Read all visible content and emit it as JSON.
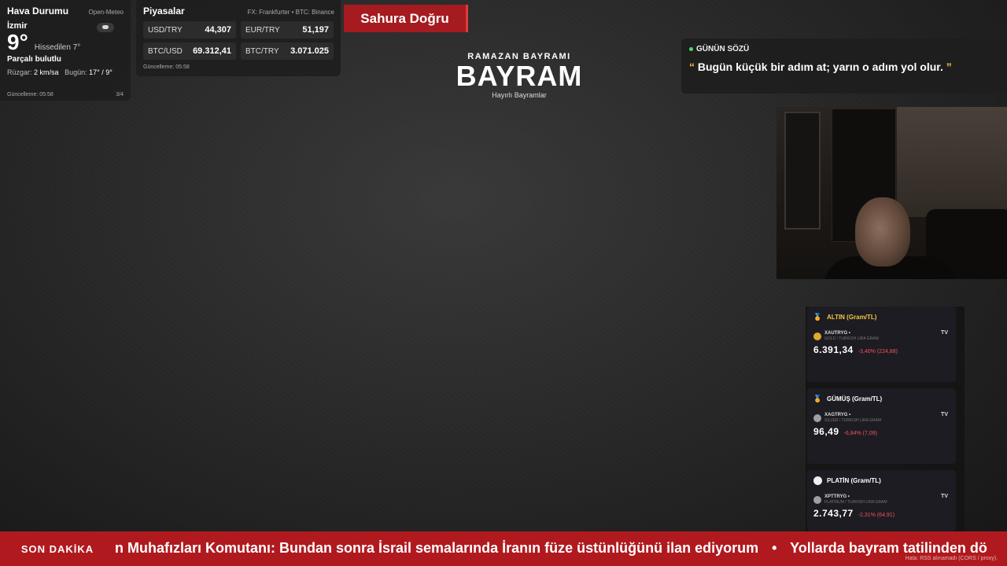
{
  "weather": {
    "title": "Hava Durumu",
    "source": "Open-Meteo",
    "city": "İzmir",
    "temp": "9°",
    "feels": "Hissedilen 7°",
    "condition": "Parçalı bulutlu",
    "wind_label": "Rüzgar:",
    "wind_value": "2 km/sa",
    "today_label": "Bugün:",
    "today_value": "17° / 9°",
    "updated": "Güncelleme: 05:58",
    "page": "3/4",
    "icon": "partly-cloudy-icon"
  },
  "markets": {
    "title": "Piyasalar",
    "source": "FX: Frankfurter • BTC: Binance",
    "items": [
      {
        "label": "USD/TRY",
        "value": "44,307"
      },
      {
        "label": "EUR/TRY",
        "value": "51,197"
      },
      {
        "label": "BTC/USD",
        "value": "69.312,41"
      },
      {
        "label": "BTC/TRY",
        "value": "3.071.025"
      }
    ],
    "updated": "Güncelleme: 05:58"
  },
  "sahur": {
    "label": "Sahura Doğru"
  },
  "bayram": {
    "subtitle": "RAMAZAN BAYRAMI",
    "title": "BAYRAM",
    "tagline": "Hayırlı Bayramlar"
  },
  "quote": {
    "header": "GÜNÜN SÖZÜ",
    "open_mark": "“",
    "close_mark": "”",
    "text": "Bugün küçük bir adım at; yarın o adım yol olur."
  },
  "metals": [
    {
      "title": "ALTIN (Gram/TL)",
      "symbol": "XAUTRYG",
      "desc": "GOLD / TURKISH LIRA GRAM",
      "price": "6.391,34",
      "change": "-3,40% (224,88)",
      "color": "#e0a82e",
      "icon": "gold-medal-icon"
    },
    {
      "title": "GÜMÜŞ (Gram/TL)",
      "symbol": "XAGTRYG",
      "desc": "SILVER / TURKISH LIRA GRAM",
      "price": "96,49",
      "change": "-6,84% (7,09)",
      "color": "#9fd3e0",
      "icon": "silver-medal-icon"
    },
    {
      "title": "PLATİN (Gram/TL)",
      "symbol": "XPTTRYG",
      "desc": "PLATINUM / TURKISH LIRA GRAM",
      "price": "2.743,77",
      "change": "-2,31% (64,91)",
      "color": "#f0f0f0",
      "icon": "platinum-circle-icon"
    }
  ],
  "metal_suffix": "•",
  "tv_label": "TV",
  "ticker": {
    "label": "SON DAKİKA",
    "items": [
      "n Muhafızları Komutanı: Bundan sonra İsrail semalarında İranın füze üstünlüğünü ilan ediyorum",
      "Yollarda bayram tatilinden dö"
    ],
    "separator": "•",
    "error": "Hata: RSS alınamadı (CORS / proxy)."
  }
}
